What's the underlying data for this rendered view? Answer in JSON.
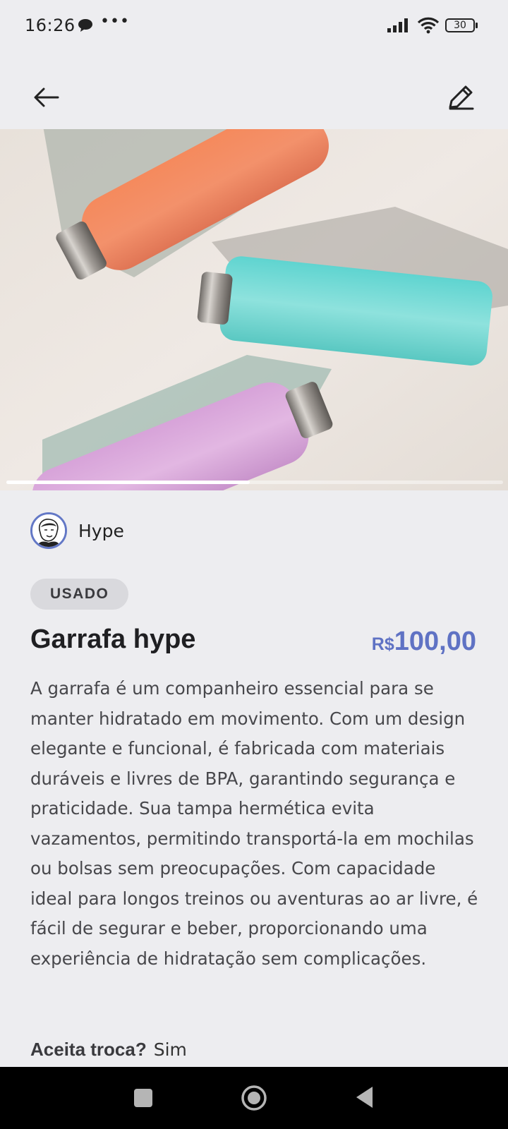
{
  "status_bar": {
    "time": "16:26",
    "dots": "•••",
    "battery": "30"
  },
  "icons": {
    "back": "arrow-left-icon",
    "edit": "pencil-icon",
    "chat": "chat-bubble-icon",
    "signal": "signal-icon",
    "wifi": "wifi-icon",
    "battery": "battery-icon",
    "nav_recents": "square-icon",
    "nav_home": "circle-icon",
    "nav_back": "triangle-back-icon"
  },
  "carousel": {
    "current_position_fraction": 0.49
  },
  "seller": {
    "name": "Hype"
  },
  "product": {
    "condition": "USADO",
    "title": "Garrafa hype",
    "price_currency": "R$",
    "price_value": "100,00",
    "description": "A garrafa é um companheiro essencial para se manter hidratado em movimento. Com um design elegante e funcional, é fabricada com materiais duráveis e livres de BPA, garantindo segurança e praticidade. Sua tampa hermética evita vazamentos, permitindo transportá-la em mochilas ou bolsas sem preocupações. Com capacidade ideal para longos treinos ou aventuras ao ar livre, é fácil de segurar e beber, proporcionando uma experiência de hidratação sem complicações.",
    "accepts_trade_label": "Aceita troca?",
    "accepts_trade_value": "Sim"
  },
  "colors": {
    "accent": "#5f72c4",
    "background": "#ededf0",
    "badge": "#d9d9dd"
  }
}
